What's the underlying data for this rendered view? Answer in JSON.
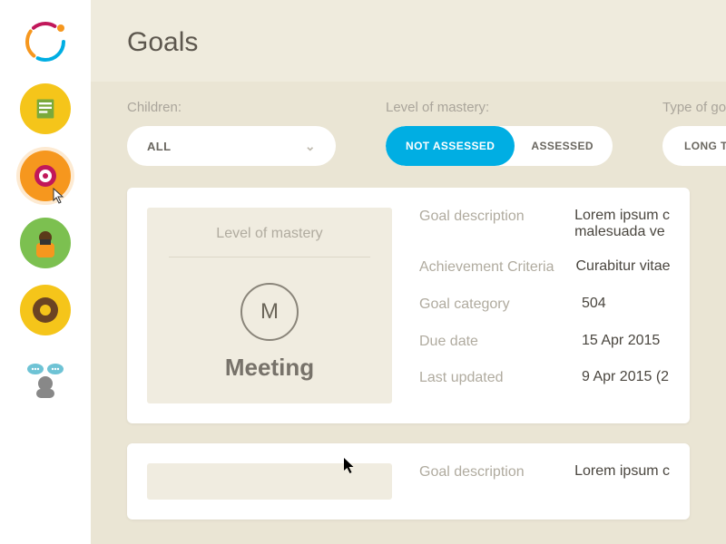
{
  "page": {
    "title": "Goals"
  },
  "filters": {
    "children": {
      "label": "Children:",
      "value": "ALL"
    },
    "mastery": {
      "label": "Level of mastery:",
      "opts": [
        "NOT ASSESSED",
        "ASSESSED"
      ],
      "active": 0
    },
    "goaltype": {
      "label": "Type of goa",
      "value": "LONG TERM"
    }
  },
  "card": {
    "mastery_heading": "Level of mastery",
    "mastery_letter": "M",
    "mastery_label": "Meeting",
    "rows": {
      "goal_desc": {
        "k": "Goal description",
        "v": "Lorem ipsum c"
      },
      "ach_crit": {
        "k": "Achievement Criteria",
        "v": "Curabitur vitae"
      },
      "goal_cat": {
        "k": "Goal category",
        "v": "504"
      },
      "due_date": {
        "k": "Due date",
        "v": "15 Apr 2015"
      },
      "last_updated": {
        "k": "Last updated",
        "v": "9 Apr 2015 (2"
      }
    },
    "goal_desc_line2": "malesuada ve"
  },
  "card2": {
    "rows": {
      "goal_desc": {
        "k": "Goal description",
        "v": "Lorem ipsum c"
      }
    }
  }
}
